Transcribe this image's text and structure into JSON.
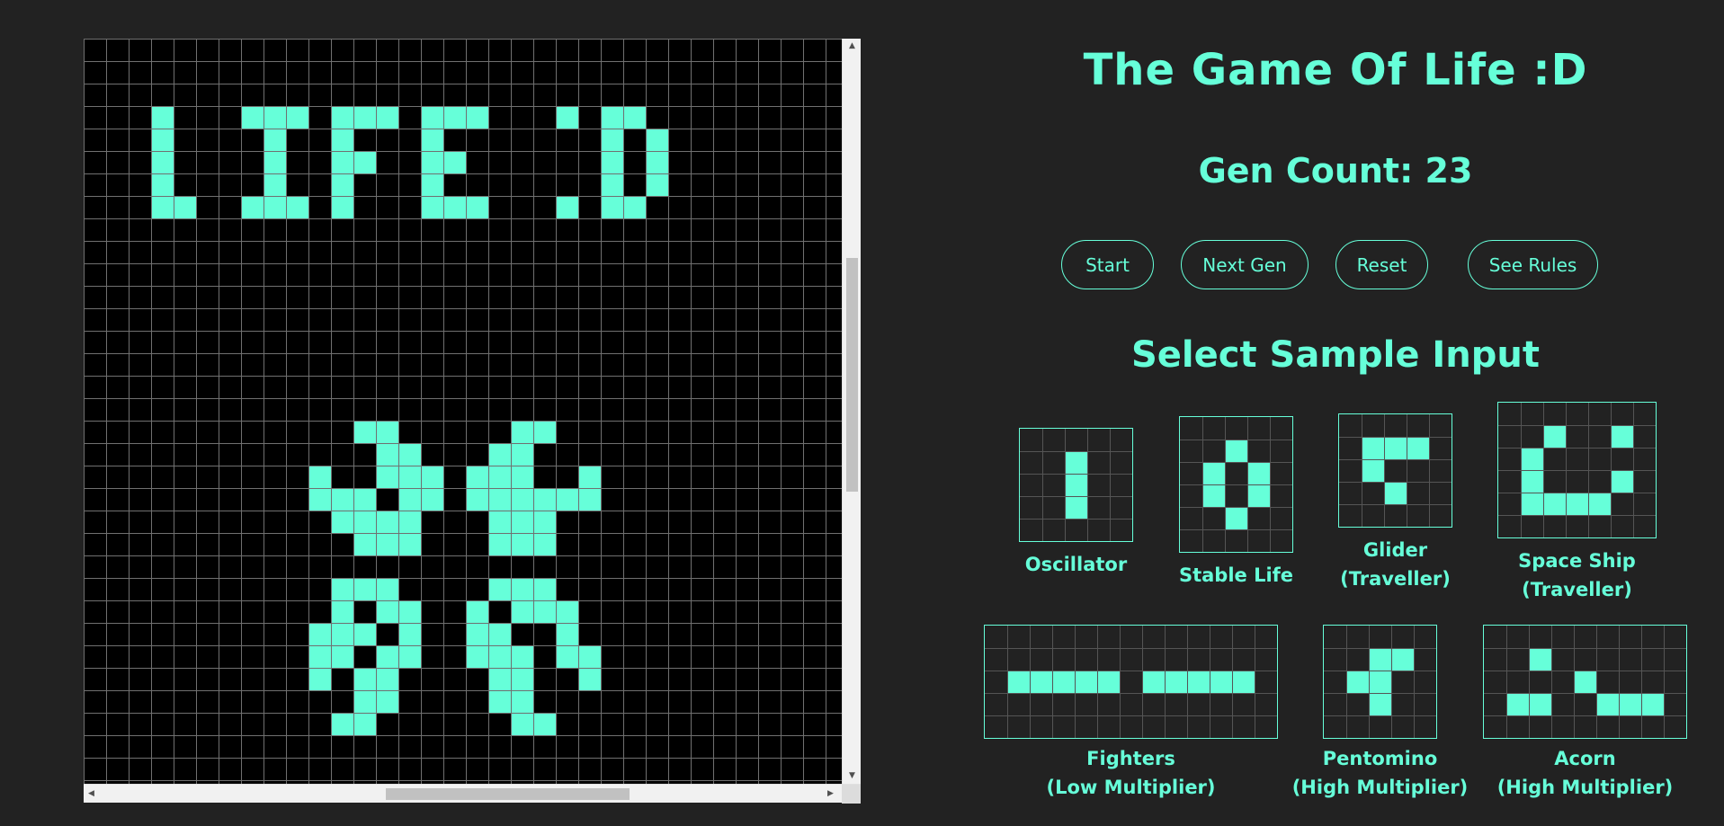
{
  "colors": {
    "background": "#222222",
    "board": "#000000",
    "grid_line": "#707070",
    "alive": "#66ffd9",
    "accent": "#66ffd9",
    "thumb_grid": "#555555"
  },
  "board": {
    "cols": 34,
    "visible_rows": 34,
    "live_cells": [
      [
        3,
        3
      ],
      [
        3,
        4
      ],
      [
        3,
        5
      ],
      [
        3,
        6
      ],
      [
        3,
        7
      ],
      [
        4,
        7
      ],
      [
        7,
        3
      ],
      [
        8,
        3
      ],
      [
        9,
        3
      ],
      [
        8,
        4
      ],
      [
        8,
        5
      ],
      [
        8,
        6
      ],
      [
        7,
        7
      ],
      [
        8,
        7
      ],
      [
        9,
        7
      ],
      [
        11,
        3
      ],
      [
        12,
        3
      ],
      [
        13,
        3
      ],
      [
        11,
        4
      ],
      [
        11,
        5
      ],
      [
        12,
        5
      ],
      [
        11,
        6
      ],
      [
        11,
        7
      ],
      [
        15,
        3
      ],
      [
        16,
        3
      ],
      [
        17,
        3
      ],
      [
        15,
        4
      ],
      [
        15,
        5
      ],
      [
        16,
        5
      ],
      [
        15,
        6
      ],
      [
        15,
        7
      ],
      [
        16,
        7
      ],
      [
        17,
        7
      ],
      [
        21,
        3
      ],
      [
        21,
        7
      ],
      [
        23,
        3
      ],
      [
        24,
        3
      ],
      [
        23,
        4
      ],
      [
        25,
        4
      ],
      [
        23,
        5
      ],
      [
        25,
        5
      ],
      [
        23,
        6
      ],
      [
        25,
        6
      ],
      [
        23,
        7
      ],
      [
        24,
        7
      ],
      [
        12,
        17
      ],
      [
        13,
        17
      ],
      [
        13,
        18
      ],
      [
        14,
        18
      ],
      [
        13,
        19
      ],
      [
        14,
        19
      ],
      [
        10,
        19
      ],
      [
        10,
        20
      ],
      [
        11,
        20
      ],
      [
        12,
        20
      ],
      [
        11,
        21
      ],
      [
        14,
        20
      ],
      [
        15,
        20
      ],
      [
        15,
        19
      ],
      [
        12,
        21
      ],
      [
        13,
        21
      ],
      [
        14,
        21
      ],
      [
        12,
        22
      ],
      [
        13,
        22
      ],
      [
        14,
        22
      ],
      [
        19,
        17
      ],
      [
        20,
        17
      ],
      [
        18,
        18
      ],
      [
        19,
        18
      ],
      [
        18,
        19
      ],
      [
        19,
        19
      ],
      [
        17,
        19
      ],
      [
        17,
        20
      ],
      [
        18,
        20
      ],
      [
        19,
        20
      ],
      [
        20,
        20
      ],
      [
        22,
        19
      ],
      [
        21,
        20
      ],
      [
        22,
        20
      ],
      [
        18,
        21
      ],
      [
        19,
        21
      ],
      [
        20,
        21
      ],
      [
        18,
        22
      ],
      [
        19,
        22
      ],
      [
        20,
        22
      ],
      [
        11,
        24
      ],
      [
        12,
        24
      ],
      [
        13,
        24
      ],
      [
        11,
        25
      ],
      [
        13,
        25
      ],
      [
        14,
        25
      ],
      [
        11,
        26
      ],
      [
        12,
        26
      ],
      [
        14,
        26
      ],
      [
        10,
        26
      ],
      [
        10,
        27
      ],
      [
        11,
        27
      ],
      [
        13,
        27
      ],
      [
        14,
        27
      ],
      [
        10,
        28
      ],
      [
        12,
        28
      ],
      [
        13,
        28
      ],
      [
        12,
        29
      ],
      [
        13,
        29
      ],
      [
        11,
        30
      ],
      [
        12,
        30
      ],
      [
        18,
        24
      ],
      [
        19,
        24
      ],
      [
        20,
        24
      ],
      [
        17,
        25
      ],
      [
        19,
        25
      ],
      [
        20,
        25
      ],
      [
        17,
        26
      ],
      [
        18,
        26
      ],
      [
        21,
        25
      ],
      [
        21,
        26
      ],
      [
        17,
        27
      ],
      [
        18,
        27
      ],
      [
        19,
        27
      ],
      [
        22,
        27
      ],
      [
        22,
        28
      ],
      [
        21,
        27
      ],
      [
        18,
        28
      ],
      [
        19,
        28
      ],
      [
        18,
        29
      ],
      [
        19,
        29
      ],
      [
        19,
        30
      ],
      [
        20,
        30
      ]
    ]
  },
  "header": {
    "title": "The Game Of Life :D",
    "gen_count": "Gen Count: 23"
  },
  "controls": {
    "start_label": "Start",
    "next_label": "Next Gen",
    "reset_label": "Reset",
    "rules_label": "See Rules"
  },
  "samples_heading": "Select Sample Input",
  "samples": [
    {
      "name": "oscillator",
      "label1": "Oscillator",
      "label2": "",
      "cols": 5,
      "rows": 5,
      "cells": [
        [
          2,
          1
        ],
        [
          2,
          2
        ],
        [
          2,
          3
        ]
      ]
    },
    {
      "name": "stable-life",
      "label1": "Stable Life",
      "label2": "",
      "cols": 5,
      "rows": 6,
      "cells": [
        [
          2,
          1
        ],
        [
          1,
          2
        ],
        [
          3,
          2
        ],
        [
          1,
          3
        ],
        [
          3,
          3
        ],
        [
          2,
          4
        ]
      ]
    },
    {
      "name": "glider",
      "label1": "Glider",
      "label2": "(Traveller)",
      "cols": 5,
      "rows": 5,
      "cells": [
        [
          1,
          1
        ],
        [
          2,
          1
        ],
        [
          3,
          1
        ],
        [
          1,
          2
        ],
        [
          2,
          3
        ]
      ]
    },
    {
      "name": "space-ship",
      "label1": "Space Ship",
      "label2": "(Traveller)",
      "cols": 7,
      "rows": 6,
      "cells": [
        [
          2,
          1
        ],
        [
          5,
          1
        ],
        [
          1,
          2
        ],
        [
          1,
          3
        ],
        [
          5,
          3
        ],
        [
          1,
          4
        ],
        [
          2,
          4
        ],
        [
          3,
          4
        ],
        [
          4,
          4
        ]
      ]
    },
    {
      "name": "fighters",
      "label1": "Fighters",
      "label2": "(Low Multiplier)",
      "cols": 13,
      "rows": 5,
      "cells": [
        [
          1,
          2
        ],
        [
          2,
          2
        ],
        [
          3,
          2
        ],
        [
          4,
          2
        ],
        [
          5,
          2
        ],
        [
          7,
          2
        ],
        [
          8,
          2
        ],
        [
          9,
          2
        ],
        [
          10,
          2
        ],
        [
          11,
          2
        ]
      ]
    },
    {
      "name": "pentomino",
      "label1": "Pentomino",
      "label2": "(High Multiplier)",
      "cols": 5,
      "rows": 5,
      "cells": [
        [
          2,
          1
        ],
        [
          3,
          1
        ],
        [
          1,
          2
        ],
        [
          2,
          2
        ],
        [
          2,
          3
        ]
      ]
    },
    {
      "name": "acorn",
      "label1": "Acorn",
      "label2": "(High Multiplier)",
      "cols": 9,
      "rows": 5,
      "cells": [
        [
          2,
          1
        ],
        [
          4,
          2
        ],
        [
          1,
          3
        ],
        [
          2,
          3
        ],
        [
          5,
          3
        ],
        [
          6,
          3
        ],
        [
          7,
          3
        ]
      ]
    }
  ]
}
